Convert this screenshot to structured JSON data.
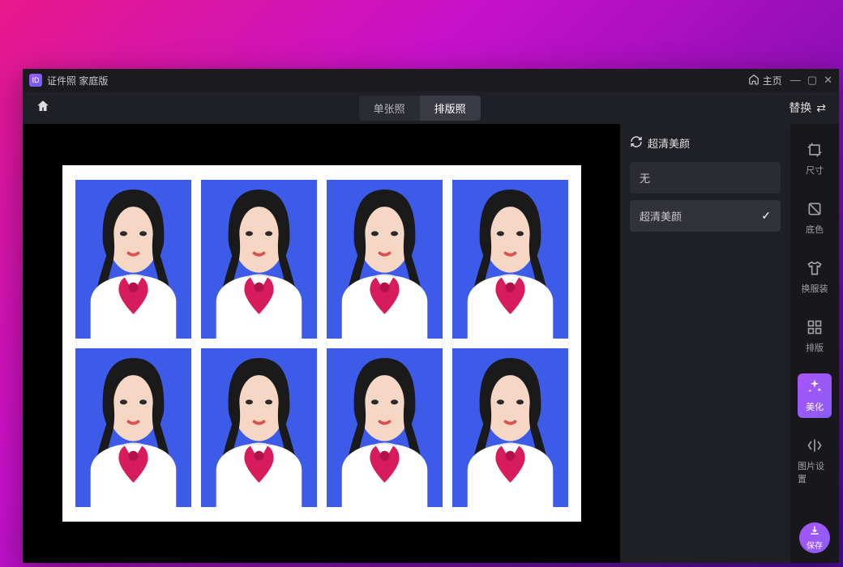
{
  "app": {
    "title": "证件照 家庭版",
    "home_label": "主页"
  },
  "topbar": {
    "tabs": [
      {
        "label": "单张照"
      },
      {
        "label": "排版照"
      }
    ],
    "active_tab_index": 1,
    "replace_label": "替换"
  },
  "canvas": {
    "grid_cols": 4,
    "grid_rows": 2,
    "photo_bg": "#3b5be8"
  },
  "beauty_panel": {
    "title": "超清美颜",
    "options": [
      {
        "label": "无",
        "selected": false
      },
      {
        "label": "超清美颜",
        "selected": true
      }
    ]
  },
  "sidebar": {
    "items": [
      {
        "label": "尺寸",
        "icon": "crop"
      },
      {
        "label": "底色",
        "icon": "swatch"
      },
      {
        "label": "换服装",
        "icon": "shirt"
      },
      {
        "label": "排版",
        "icon": "grid"
      },
      {
        "label": "美化",
        "icon": "sparkle",
        "active": true
      },
      {
        "label": "图片设置",
        "icon": "mirror"
      }
    ],
    "save_label": "保存"
  }
}
